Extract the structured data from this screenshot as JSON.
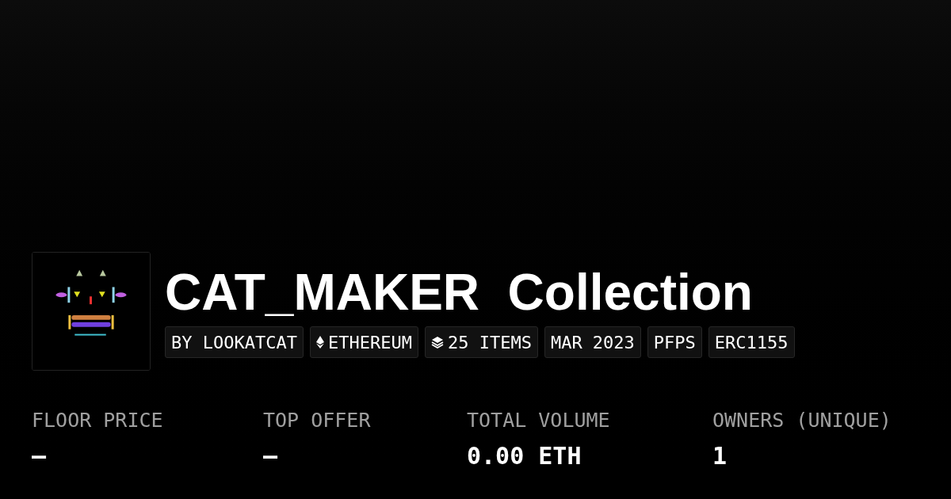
{
  "collection": {
    "title": "CAT_MAKER  Collection",
    "tags": [
      {
        "kind": "plain",
        "label": "BY LOOKATCAT"
      },
      {
        "kind": "chain",
        "label": "ETHEREUM"
      },
      {
        "kind": "items",
        "label": "25 ITEMS"
      },
      {
        "kind": "plain",
        "label": "MAR 2023"
      },
      {
        "kind": "plain",
        "label": "PFPS"
      },
      {
        "kind": "plain",
        "label": "ERC1155"
      }
    ]
  },
  "stats": [
    {
      "label": "FLOOR PRICE",
      "value": "—"
    },
    {
      "label": "TOP OFFER",
      "value": "—"
    },
    {
      "label": "TOTAL VOLUME",
      "value": "0.00 ETH"
    },
    {
      "label": "OWNERS (UNIQUE)",
      "value": "1"
    }
  ]
}
